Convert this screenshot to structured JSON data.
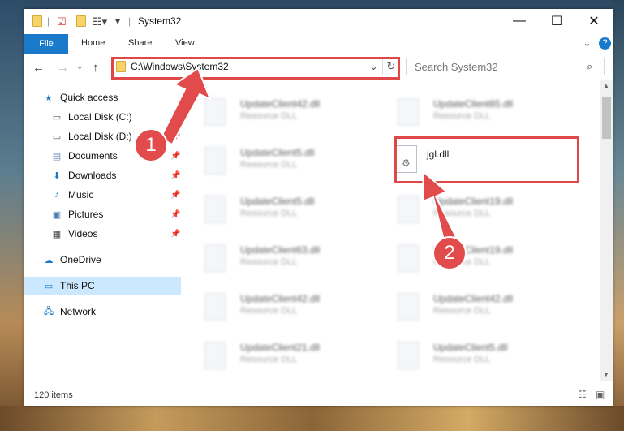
{
  "window": {
    "title": "System32",
    "controls": {
      "minimize": "—",
      "maximize": "☐",
      "close": "✕"
    }
  },
  "ribbon": {
    "tabs": [
      "File",
      "Home",
      "Share",
      "View"
    ]
  },
  "nav": {
    "address": "C:\\Windows\\System32",
    "search_placeholder": "Search System32"
  },
  "sidebar": {
    "items": [
      {
        "label": "Quick access",
        "icon": "star-icon",
        "pinned": false
      },
      {
        "label": "Local Disk (C:)",
        "icon": "drive-icon",
        "pinned": true
      },
      {
        "label": "Local Disk (D:)",
        "icon": "drive-icon",
        "pinned": true
      },
      {
        "label": "Documents",
        "icon": "documents-icon",
        "pinned": true
      },
      {
        "label": "Downloads",
        "icon": "downloads-icon",
        "pinned": true
      },
      {
        "label": "Music",
        "icon": "music-icon",
        "pinned": true
      },
      {
        "label": "Pictures",
        "icon": "pictures-icon",
        "pinned": true
      },
      {
        "label": "Videos",
        "icon": "videos-icon",
        "pinned": true
      },
      {
        "label": "OneDrive",
        "icon": "cloud-icon",
        "pinned": false
      },
      {
        "label": "This PC",
        "icon": "pc-icon",
        "pinned": false,
        "selected": true
      },
      {
        "label": "Network",
        "icon": "network-icon",
        "pinned": false
      }
    ]
  },
  "files": {
    "left_column": [
      {
        "name": "UpdateClient42.dll",
        "type": "Resource DLL"
      },
      {
        "name": "UpdateClient5.dll",
        "type": "Resource DLL"
      },
      {
        "name": "UpdateClient5.dll",
        "type": "Resource DLL"
      },
      {
        "name": "UpdateClient63.dll",
        "type": "Resource DLL"
      },
      {
        "name": "UpdateClient42.dll",
        "type": "Resource DLL"
      },
      {
        "name": "UpdateClient21.dll",
        "type": "Resource DLL"
      }
    ],
    "right_column": [
      {
        "name": "UpdateClient65.dll",
        "type": "Resource DLL"
      },
      {
        "name": "jgl.dll",
        "type": ""
      },
      {
        "name": "UpdateClient19.dll",
        "type": "Resource DLL"
      },
      {
        "name": "UpdateClient19.dll",
        "type": "Resource DLL"
      },
      {
        "name": "UpdateClient42.dll",
        "type": "Resource DLL"
      },
      {
        "name": "UpdateClient5.dll",
        "type": "Resource DLL"
      }
    ]
  },
  "status": {
    "item_count": "120 items"
  },
  "annotations": {
    "badge1": "1",
    "badge2": "2"
  },
  "colors": {
    "file_tab": "#1979ca",
    "highlight": "#e04848",
    "selected_row": "#cce8ff"
  }
}
